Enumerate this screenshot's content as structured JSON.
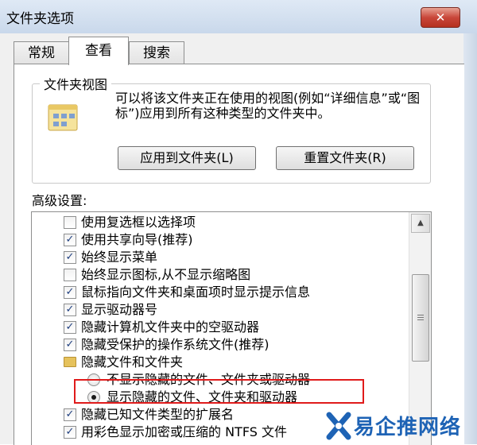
{
  "window": {
    "title": "文件夹选项",
    "close_label": "✕"
  },
  "tabs": [
    {
      "label": "常规",
      "active": false
    },
    {
      "label": "查看",
      "active": true
    },
    {
      "label": "搜索",
      "active": false
    }
  ],
  "folder_views": {
    "group_title": "文件夹视图",
    "description": "可以将该文件夹正在使用的视图(例如“详细信息”或“图标”)应用到所有这种类型的文件夹中。",
    "apply_label": "应用到文件夹(L)",
    "reset_label": "重置文件夹(R)"
  },
  "advanced": {
    "label": "高级设置:",
    "items": [
      {
        "type": "checkbox",
        "checked": false,
        "label": "使用复选框以选择项"
      },
      {
        "type": "checkbox",
        "checked": true,
        "label": "使用共享向导(推荐)"
      },
      {
        "type": "checkbox",
        "checked": true,
        "label": "始终显示菜单"
      },
      {
        "type": "checkbox",
        "checked": false,
        "label": "始终显示图标,从不显示缩略图"
      },
      {
        "type": "checkbox",
        "checked": true,
        "label": "鼠标指向文件夹和桌面项时显示提示信息"
      },
      {
        "type": "checkbox",
        "checked": true,
        "label": "显示驱动器号"
      },
      {
        "type": "checkbox",
        "checked": true,
        "label": "隐藏计算机文件夹中的空驱动器"
      },
      {
        "type": "checkbox",
        "checked": true,
        "label": "隐藏受保护的操作系统文件(推荐)"
      },
      {
        "type": "folder",
        "label": "隐藏文件和文件夹"
      },
      {
        "type": "radio",
        "checked": false,
        "label": "不显示隐藏的文件、文件夹或驱动器"
      },
      {
        "type": "radio",
        "checked": true,
        "label": "显示隐藏的文件、文件夹和驱动器"
      },
      {
        "type": "checkbox",
        "checked": true,
        "label": "隐藏已知文件类型的扩展名"
      },
      {
        "type": "checkbox",
        "checked": true,
        "label": "用彩色显示加密或压缩的 NTFS 文件"
      }
    ]
  },
  "watermark": {
    "text": "易企推网络",
    "colors": {
      "blue": "#1e63b5"
    }
  },
  "colors": {
    "highlight_box": "#e01b1b",
    "close_button": "#c9473a"
  }
}
